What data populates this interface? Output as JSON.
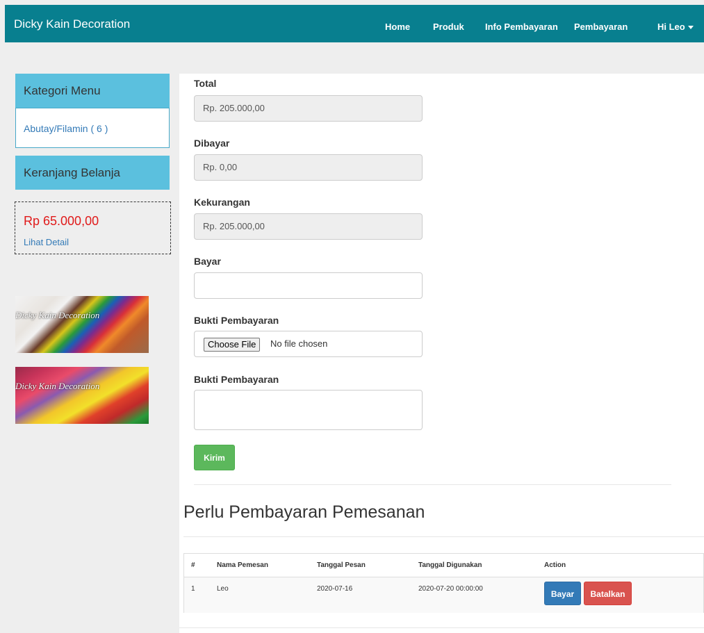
{
  "navbar": {
    "brand": "Dicky Kain Decoration",
    "links": [
      "Home",
      "Produk",
      "Info Pembayaran",
      "Pembayaran"
    ],
    "user": "Hi Leo"
  },
  "sidebar": {
    "category_title": "Kategori Menu",
    "category_item": "Abutay/Filamin ( 6 )",
    "cart_title": "Keranjang Belanja",
    "cart_total": "Rp 65.000,00",
    "cart_detail": "Lihat Detail",
    "banners": [
      "Dicky Kain Decoration",
      "Dicky Kain Decoration"
    ]
  },
  "form": {
    "total_label": "Total",
    "total_value": "Rp. 205.000,00",
    "dibayar_label": "Dibayar",
    "dibayar_value": "Rp. 0,00",
    "kekurangan_label": "Kekurangan",
    "kekurangan_value": "Rp. 205.000,00",
    "bayar_label": "Bayar",
    "bayar_value": "",
    "bukti_label": "Bukti Pembayaran",
    "file_button": "Choose File",
    "file_status": "No file chosen",
    "bukti2_label": "Bukti Pembayaran",
    "bukti2_value": "",
    "submit": "Kirim"
  },
  "pending": {
    "title": "Perlu Pembayaran Pemesanan",
    "headers": [
      "#",
      "Nama Pemesan",
      "Tanggal Pesan",
      "Tanggal Digunakan",
      "Action"
    ],
    "rows": [
      {
        "no": "1",
        "nama": "Leo",
        "tanggal_pesan": "2020-07-16",
        "tanggal_digunakan": "2020-07-20 00:00:00",
        "bayar": "Bayar",
        "batalkan": "Batalkan"
      }
    ]
  },
  "colors": {
    "navbar": "#087f8f",
    "sidebar_header": "#5bc0de",
    "success": "#5cb85c",
    "primary": "#337ab7",
    "danger": "#d9534f",
    "price": "#e01a1a"
  }
}
